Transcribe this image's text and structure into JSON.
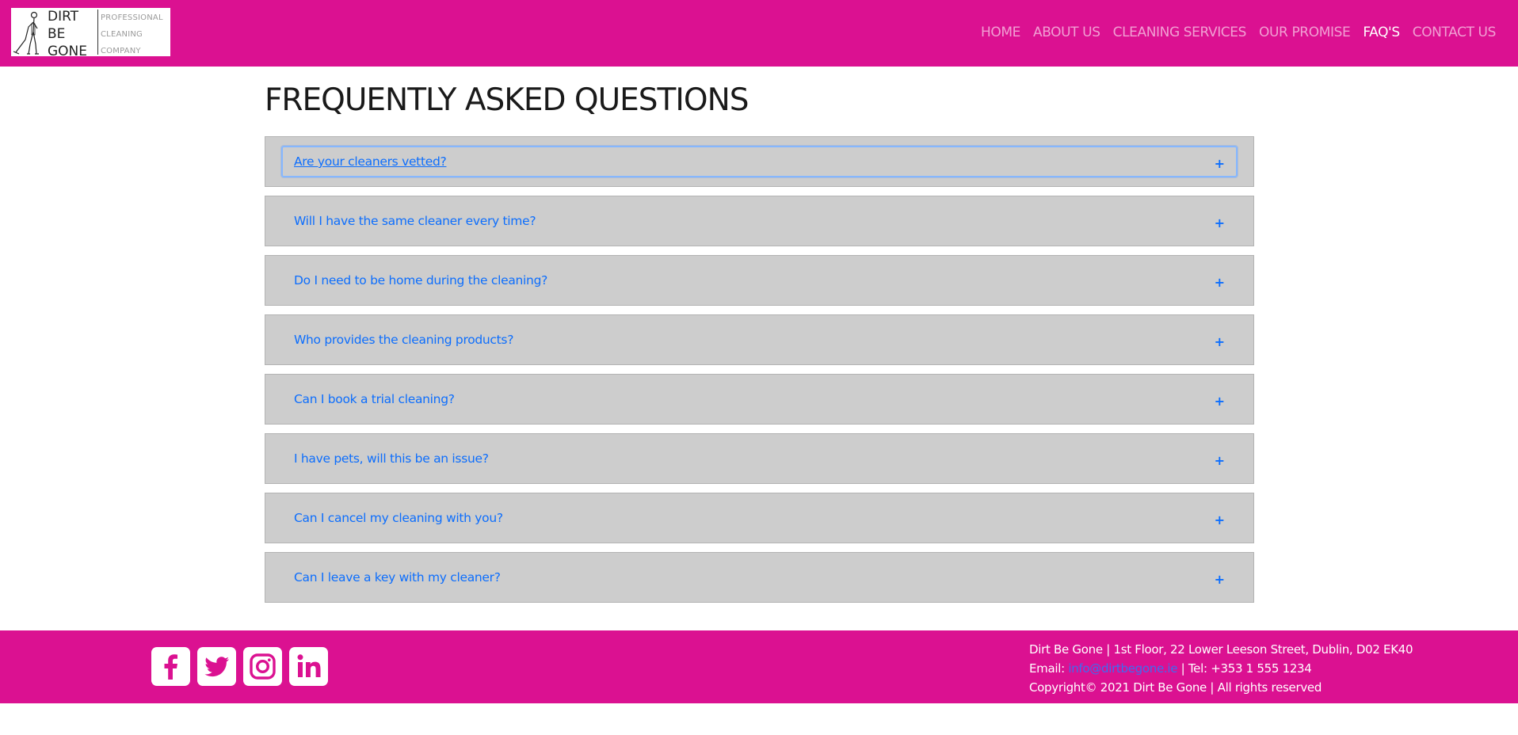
{
  "brand": {
    "logo_main": [
      "DIRT",
      "BE",
      "GONE"
    ],
    "logo_sub": [
      "PROFESSIONAL",
      "CLEANING",
      "COMPANY"
    ]
  },
  "nav": {
    "items": [
      {
        "label": "HOME",
        "active": false
      },
      {
        "label": "ABOUT US",
        "active": false
      },
      {
        "label": "CLEANING SERVICES",
        "active": false
      },
      {
        "label": "OUR PROMISE",
        "active": false
      },
      {
        "label": "FAQ'S",
        "active": true
      },
      {
        "label": "CONTACT US",
        "active": false
      }
    ]
  },
  "page": {
    "title": "FREQUENTLY ASKED QUESTIONS"
  },
  "faq": {
    "expand_symbol": "+",
    "items": [
      {
        "question": "Are your cleaners vetted?",
        "focused": true
      },
      {
        "question": "Will I have the same cleaner every time?",
        "focused": false
      },
      {
        "question": "Do I need to be home during the cleaning?",
        "focused": false
      },
      {
        "question": "Who provides the cleaning products?",
        "focused": false
      },
      {
        "question": "Can I book a trial cleaning?",
        "focused": false
      },
      {
        "question": "I have pets, will this be an issue?",
        "focused": false
      },
      {
        "question": "Can I cancel my cleaning with you?",
        "focused": false
      },
      {
        "question": "Can I leave a key with my cleaner?",
        "focused": false
      }
    ]
  },
  "footer": {
    "social": [
      "facebook-icon",
      "twitter-icon",
      "instagram-icon",
      "linkedin-icon"
    ],
    "address": "Dirt Be Gone | 1st Floor, 22 Lower Leeson Street, Dublin, D02 EK40",
    "email_label": "Email: ",
    "email": "info@dirtbegone.ie",
    "tel": " | Tel: +353 1 555 1234",
    "copyright": "Copyright© 2021 Dirt Be Gone | All rights reserved"
  },
  "colors": {
    "brand_pink": "#db1191",
    "accordion_bg": "#cdcdcd",
    "link_blue": "#0d6efd"
  }
}
